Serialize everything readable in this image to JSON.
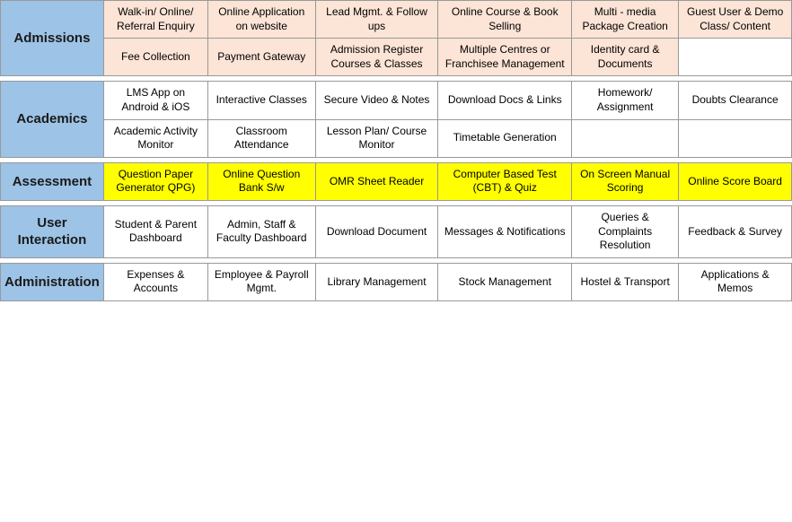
{
  "sections": [
    {
      "id": "admissions",
      "label": "Admissions",
      "rows": [
        [
          {
            "text": "Walk-in/ Online/ Referral Enquiry",
            "style": "peach"
          },
          {
            "text": "Online Application on website",
            "style": "peach"
          },
          {
            "text": "Lead Mgmt. & Follow ups",
            "style": "peach"
          },
          {
            "text": "Online Course & Book Selling",
            "style": "peach"
          },
          {
            "text": "Multi - media Package Creation",
            "style": "peach"
          },
          {
            "text": "Guest User & Demo Class/ Content",
            "style": "peach"
          }
        ],
        [
          {
            "text": "Fee Collection",
            "style": "peach"
          },
          {
            "text": "Payment Gateway",
            "style": "peach"
          },
          {
            "text": "Admission Register Courses & Classes",
            "style": "peach"
          },
          {
            "text": "Multiple Centres or Franchisee Management",
            "style": "peach"
          },
          {
            "text": "Identity card & Documents",
            "style": "peach"
          },
          {
            "text": "",
            "style": "white"
          }
        ]
      ]
    },
    {
      "id": "academics",
      "label": "Academics",
      "rows": [
        [
          {
            "text": "LMS App on Android & iOS",
            "style": "white"
          },
          {
            "text": "Interactive Classes",
            "style": "white"
          },
          {
            "text": "Secure Video & Notes",
            "style": "white"
          },
          {
            "text": "Download Docs & Links",
            "style": "white"
          },
          {
            "text": "Homework/ Assignment",
            "style": "white"
          },
          {
            "text": "Doubts Clearance",
            "style": "white"
          }
        ],
        [
          {
            "text": "Academic Activity Monitor",
            "style": "white"
          },
          {
            "text": "Classroom Attendance",
            "style": "white"
          },
          {
            "text": "Lesson Plan/ Course Monitor",
            "style": "white"
          },
          {
            "text": "Timetable Generation",
            "style": "white"
          },
          {
            "text": "",
            "style": "white"
          },
          {
            "text": "",
            "style": "white"
          }
        ]
      ]
    },
    {
      "id": "assessment",
      "label": "Assessment",
      "rows": [
        [
          {
            "text": "Question Paper Generator QPG)",
            "style": "yellow"
          },
          {
            "text": "Online Question Bank S/w",
            "style": "yellow"
          },
          {
            "text": "OMR Sheet Reader",
            "style": "yellow"
          },
          {
            "text": "Computer Based Test (CBT) & Quiz",
            "style": "yellow"
          },
          {
            "text": "On Screen Manual Scoring",
            "style": "yellow"
          },
          {
            "text": "Online Score Board",
            "style": "yellow"
          }
        ]
      ]
    },
    {
      "id": "user-interaction",
      "label": "User Interaction",
      "rows": [
        [
          {
            "text": "Student & Parent Dashboard",
            "style": "white"
          },
          {
            "text": "Admin, Staff & Faculty Dashboard",
            "style": "white"
          },
          {
            "text": "Download Document",
            "style": "white"
          },
          {
            "text": "Messages & Notifications",
            "style": "white"
          },
          {
            "text": "Queries & Complaints Resolution",
            "style": "white"
          },
          {
            "text": "Feedback & Survey",
            "style": "white"
          }
        ]
      ]
    },
    {
      "id": "administration",
      "label": "Administration",
      "rows": [
        [
          {
            "text": "Expenses & Accounts",
            "style": "white"
          },
          {
            "text": "Employee & Payroll Mgmt.",
            "style": "white"
          },
          {
            "text": "Library Management",
            "style": "white"
          },
          {
            "text": "Stock Management",
            "style": "white"
          },
          {
            "text": "Hostel & Transport",
            "style": "white"
          },
          {
            "text": "Applications & Memos",
            "style": "white"
          }
        ]
      ]
    }
  ]
}
